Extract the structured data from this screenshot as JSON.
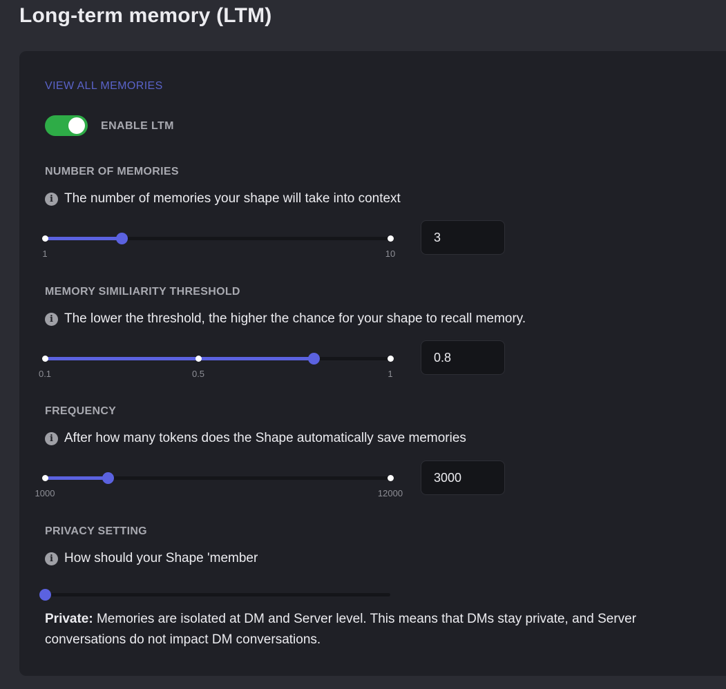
{
  "page": {
    "title": "Long-term memory (LTM)"
  },
  "ltm": {
    "view_all_label": "VIEW ALL MEMORIES",
    "enable_label": "ENABLE LTM",
    "enabled": true,
    "colors": {
      "accent": "#5b62e0",
      "toggle_on": "#2eac47",
      "link": "#5a63c9"
    }
  },
  "sections": {
    "memories": {
      "label": "NUMBER OF MEMORIES",
      "info_icon": "info-icon",
      "description": "The number of memories your shape will take into context",
      "slider": {
        "min": 1,
        "max": 10,
        "value": 3,
        "min_label": "1",
        "max_label": "10"
      },
      "input_value": "3"
    },
    "threshold": {
      "label": "MEMORY SIMILIARITY THRESHOLD",
      "info_icon": "info-icon",
      "description": "The lower the threshold, the higher the chance for your shape to recall memory.",
      "slider": {
        "min": 0.1,
        "max": 1,
        "value": 0.8,
        "min_label": "0.1",
        "mid_label": "0.5",
        "max_label": "1"
      },
      "input_value": "0.8"
    },
    "frequency": {
      "label": "FREQUENCY",
      "info_icon": "info-icon",
      "description": "After how many tokens does the Shape automatically save memories",
      "slider": {
        "min": 1000,
        "max": 12000,
        "value": 3000,
        "min_label": "1000",
        "max_label": "12000"
      },
      "input_value": "3000"
    },
    "privacy": {
      "label": "PRIVACY SETTING",
      "info_icon": "info-icon",
      "description": "How should your Shape 'member",
      "slider": {
        "position": 0
      },
      "mode_label": "Private:",
      "mode_description": " Memories are isolated at DM and Server level. This means that DMs stay private, and Server conversations do not impact DM conversations."
    }
  }
}
